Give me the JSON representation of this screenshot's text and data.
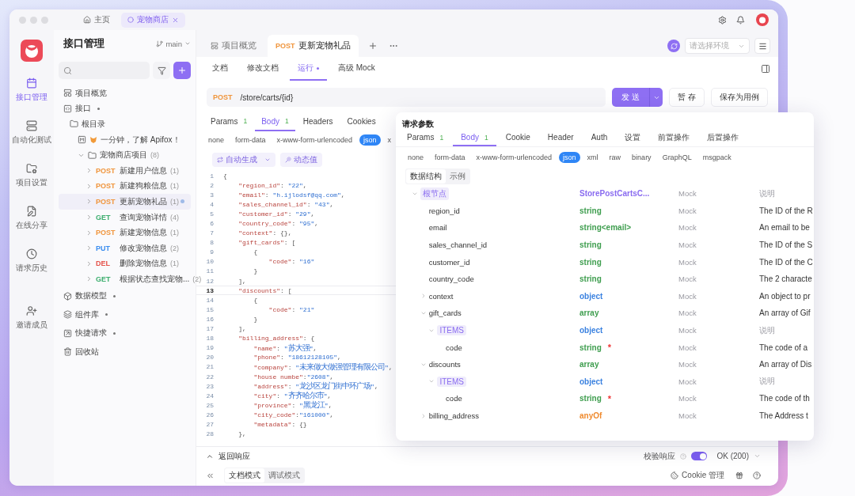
{
  "titlebar": {
    "tabs": [
      {
        "kind": "home",
        "label": "主页",
        "selected": false
      },
      {
        "kind": "project",
        "label": "宠物商店",
        "selected": true
      }
    ]
  },
  "rail": {
    "items": [
      {
        "kind": "api",
        "label": "接口管理",
        "selected": true
      },
      {
        "kind": "test",
        "label": "自动化测试",
        "selected": false
      },
      {
        "kind": "settings",
        "label": "项目设置",
        "selected": false
      },
      {
        "kind": "share",
        "label": "在线分享",
        "selected": false
      },
      {
        "kind": "history",
        "label": "请求历史",
        "selected": false
      },
      {
        "kind": "invite",
        "label": "邀请成员",
        "selected": false
      }
    ]
  },
  "sidebar": {
    "title": "接口管理",
    "branch": "main",
    "tree": [
      {
        "kind": "overview",
        "label": "项目概览"
      },
      {
        "kind": "api",
        "label": "接口",
        "dot": true,
        "children": [
          {
            "kind": "root",
            "label": "根目录",
            "children": [
              {
                "kind": "doc",
                "label": "一分钟，了解 Apifox！"
              },
              {
                "kind": "folder",
                "label": "宠物商店项目",
                "count": "(8)",
                "expanded": true,
                "children": [
                  {
                    "kind": "endpoint",
                    "method": "POST",
                    "color": "#f0953c",
                    "label": "新建用户信息",
                    "count": "(1)",
                    "expanded": false,
                    "selected": false
                  },
                  {
                    "kind": "endpoint",
                    "method": "POST",
                    "color": "#f0953c",
                    "label": "新建狗粮信息",
                    "count": "(1)",
                    "expanded": false,
                    "selected": false
                  },
                  {
                    "kind": "endpoint",
                    "method": "POST",
                    "color": "#f0953c",
                    "label": "更新宠物礼品",
                    "count": "(1)",
                    "expanded": false,
                    "selected": true
                  },
                  {
                    "kind": "endpoint",
                    "method": "GET",
                    "color": "#3cae6e",
                    "label": "查询宠物详情",
                    "count": "(4)",
                    "expanded": false,
                    "selected": false
                  },
                  {
                    "kind": "endpoint",
                    "method": "POST",
                    "color": "#f0953c",
                    "label": "新建宠物信息",
                    "count": "(1)",
                    "expanded": false,
                    "selected": false
                  },
                  {
                    "kind": "endpoint",
                    "method": "PUT",
                    "color": "#3b8def",
                    "label": "修改宠物信息",
                    "count": "(2)",
                    "expanded": false,
                    "selected": false
                  },
                  {
                    "kind": "endpoint",
                    "method": "DEL",
                    "color": "#e5534b",
                    "label": "删除宠物信息",
                    "count": "(1)",
                    "expanded": false,
                    "selected": false
                  },
                  {
                    "kind": "endpoint",
                    "method": "GET",
                    "color": "#3cae6e",
                    "label": "根据状态查找宠物...",
                    "count": "(2)",
                    "expanded": false,
                    "selected": false
                  }
                ]
              }
            ]
          }
        ]
      },
      {
        "kind": "model",
        "label": "数据模型",
        "dot": true
      },
      {
        "kind": "library",
        "label": "组件库",
        "dot": true
      },
      {
        "kind": "quick",
        "label": "快捷请求",
        "dot": true
      },
      {
        "kind": "trash",
        "label": "回收站"
      }
    ]
  },
  "tabs": [
    {
      "kind": "overview",
      "label": "项目概览",
      "selected": false
    },
    {
      "kind": "request",
      "method": "POST",
      "label": "更新宠物礼品",
      "selected": true
    }
  ],
  "environment": {
    "placeholder": "请选择环境"
  },
  "subtabs": [
    {
      "label": "文档",
      "selected": false,
      "modified": false
    },
    {
      "label": "修改文档",
      "selected": false,
      "modified": false
    },
    {
      "label": "运行",
      "selected": true,
      "modified": true
    },
    {
      "label": "高级 Mock",
      "selected": false,
      "modified": false
    }
  ],
  "request": {
    "method": "POST",
    "path": "/store/carts/{id}",
    "send": "发 送",
    "save_draft": "暂 存",
    "save_case": "保存为用例"
  },
  "param_tabs": [
    {
      "label": "Params",
      "count": "1",
      "selected": false
    },
    {
      "label": "Body",
      "count": "1",
      "selected": true
    },
    {
      "label": "Headers",
      "selected": false
    },
    {
      "label": "Cookies",
      "selected": false
    }
  ],
  "body_types": [
    {
      "label": "none",
      "selected": false
    },
    {
      "label": "form-data",
      "selected": false
    },
    {
      "label": "x-www-form-urlencoded",
      "selected": false
    },
    {
      "label": "json",
      "selected": true
    },
    {
      "label": "x",
      "selected": false
    }
  ],
  "tools": {
    "generate": "自动生成",
    "dynamic": "动态值"
  },
  "code": [
    {
      "no": "1",
      "text": "{",
      "current": false
    },
    {
      "no": "2",
      "text": "    \"region_id\": \"22\",",
      "current": false
    },
    {
      "no": "3",
      "text": "    \"email\": \"h.ijlodsf@qq.com\",",
      "current": false
    },
    {
      "no": "4",
      "text": "    \"sales_channel_id\": \"43\",",
      "current": false
    },
    {
      "no": "5",
      "text": "    \"customer_id\": \"29\",",
      "current": false
    },
    {
      "no": "6",
      "text": "    \"country_code\": \"95\",",
      "current": false
    },
    {
      "no": "7",
      "text": "    \"context\": {},",
      "current": false
    },
    {
      "no": "8",
      "text": "    \"gift_cards\": [",
      "current": false
    },
    {
      "no": "9",
      "text": "        {",
      "current": false
    },
    {
      "no": "10",
      "text": "            \"code\": \"16\"",
      "current": false
    },
    {
      "no": "11",
      "text": "        }",
      "current": false
    },
    {
      "no": "12",
      "text": "    ],",
      "current": false
    },
    {
      "no": "13",
      "text": "    \"discounts\": [",
      "current": true
    },
    {
      "no": "14",
      "text": "        {",
      "current": false
    },
    {
      "no": "15",
      "text": "            \"code\": \"21\"",
      "current": false
    },
    {
      "no": "16",
      "text": "        }",
      "current": false
    },
    {
      "no": "17",
      "text": "    ],",
      "current": false
    },
    {
      "no": "18",
      "text": "    \"billing_address\": {",
      "current": false
    },
    {
      "no": "19",
      "text": "        \"name\": \"苏大强\",",
      "current": false
    },
    {
      "no": "20",
      "text": "        \"phone\": \"18612128105\",",
      "current": false
    },
    {
      "no": "21",
      "text": "        \"company\": \"未来做大做强管理有限公司\",",
      "current": false
    },
    {
      "no": "22",
      "text": "        \"house numbe\":\"2608\",",
      "current": false
    },
    {
      "no": "23",
      "text": "        \"address\": \"龙沙区龙门街中环广场\",",
      "current": false
    },
    {
      "no": "24",
      "text": "        \"city\": \"齐齐哈尔市\",",
      "current": false
    },
    {
      "no": "25",
      "text": "        \"province\": \"黑龙江\",",
      "current": false
    },
    {
      "no": "26",
      "text": "        \"city_code\":\"161000\",",
      "current": false
    },
    {
      "no": "27",
      "text": "        \"metadata\": {}",
      "current": false
    },
    {
      "no": "28",
      "text": "    },",
      "current": false
    }
  ],
  "response": {
    "label": "返回响应",
    "validate": "校验响应",
    "validate_on": true,
    "status": "OK (200)"
  },
  "bottom_bar": {
    "modes": [
      {
        "label": "文档模式",
        "selected": true
      },
      {
        "label": "调试模式",
        "selected": false
      }
    ],
    "cookie": "Cookie 管理"
  },
  "params_panel": {
    "title": "请求参数",
    "tabs": [
      {
        "label": "Params",
        "count": "1",
        "selected": false
      },
      {
        "label": "Body",
        "count": "1",
        "selected": true
      },
      {
        "label": "Cookie",
        "selected": false
      },
      {
        "label": "Header",
        "selected": false
      },
      {
        "label": "Auth",
        "selected": false
      },
      {
        "label": "设置",
        "selected": false
      },
      {
        "label": "前置操作",
        "selected": false
      },
      {
        "label": "后置操作",
        "selected": false
      }
    ],
    "body_types": [
      {
        "label": "none",
        "selected": false
      },
      {
        "label": "form-data",
        "selected": false
      },
      {
        "label": "x-www-form-urlencoded",
        "selected": false
      },
      {
        "label": "json",
        "selected": true
      },
      {
        "label": "xml",
        "selected": false
      },
      {
        "label": "raw",
        "selected": false
      },
      {
        "label": "binary",
        "selected": false
      },
      {
        "label": "GraphQL",
        "selected": false
      },
      {
        "label": "msgpack",
        "selected": false
      }
    ],
    "views": [
      {
        "label": "数据结构",
        "selected": true
      },
      {
        "label": "示例",
        "selected": false
      }
    ],
    "schema": [
      {
        "kind": "tag",
        "name": "根节点",
        "type": "StorePostCartsC...",
        "color": "#8a6cf0",
        "mock": "Mock",
        "placeholder": "说明",
        "expanded": true,
        "children": [
          {
            "kind": "field",
            "name": "region_id",
            "type": "string",
            "color": "#3f9e4f",
            "mock": "Mock",
            "description": "The ID of the R"
          },
          {
            "kind": "field",
            "name": "email",
            "type": "string<email>",
            "color": "#3f9e4f",
            "mock": "Mock",
            "description": "An email to be"
          },
          {
            "kind": "field",
            "name": "sales_channel_id",
            "type": "string",
            "color": "#3f9e4f",
            "mock": "Mock",
            "description": "The ID of the S"
          },
          {
            "kind": "field",
            "name": "customer_id",
            "type": "string",
            "color": "#3f9e4f",
            "mock": "Mock",
            "description": "The ID of the C"
          },
          {
            "kind": "field",
            "name": "country_code",
            "type": "string",
            "color": "#3f9e4f",
            "mock": "Mock",
            "description": "The 2 characte"
          },
          {
            "kind": "field",
            "name": "context",
            "type": "object",
            "color": "#3b82e0",
            "mock": "Mock",
            "description": "An object to pr",
            "expanded": false
          },
          {
            "kind": "field",
            "name": "gift_cards",
            "type": "array",
            "color": "#3f9e4f",
            "mock": "Mock",
            "description": "An array of Gif",
            "expanded": true,
            "children": [
              {
                "kind": "tag",
                "name": "ITEMS",
                "type": "object",
                "color": "#3b82e0",
                "mock": "Mock",
                "placeholder": "说明",
                "expanded": true,
                "children": [
                  {
                    "kind": "field",
                    "name": "code",
                    "type": "string",
                    "color": "#3f9e4f",
                    "required_mark": "*",
                    "mock": "Mock",
                    "description": "The code of a"
                  }
                ]
              }
            ]
          },
          {
            "kind": "field",
            "name": "discounts",
            "type": "array",
            "color": "#3f9e4f",
            "mock": "Mock",
            "description": "An array of Dis",
            "expanded": true,
            "children": [
              {
                "kind": "tag",
                "name": "ITEMS",
                "type": "object",
                "color": "#3b82e0",
                "mock": "Mock",
                "placeholder": "说明",
                "expanded": true,
                "children": [
                  {
                    "kind": "field",
                    "name": "code",
                    "type": "string",
                    "color": "#3f9e4f",
                    "required_mark": "*",
                    "mock": "Mock",
                    "description": "The code of th"
                  }
                ]
              }
            ]
          },
          {
            "kind": "field",
            "name": "billing_address",
            "type": "anyOf",
            "color": "#ef8a2e",
            "mock": "Mock",
            "description": "The Address t",
            "expanded": false
          }
        ]
      }
    ]
  }
}
